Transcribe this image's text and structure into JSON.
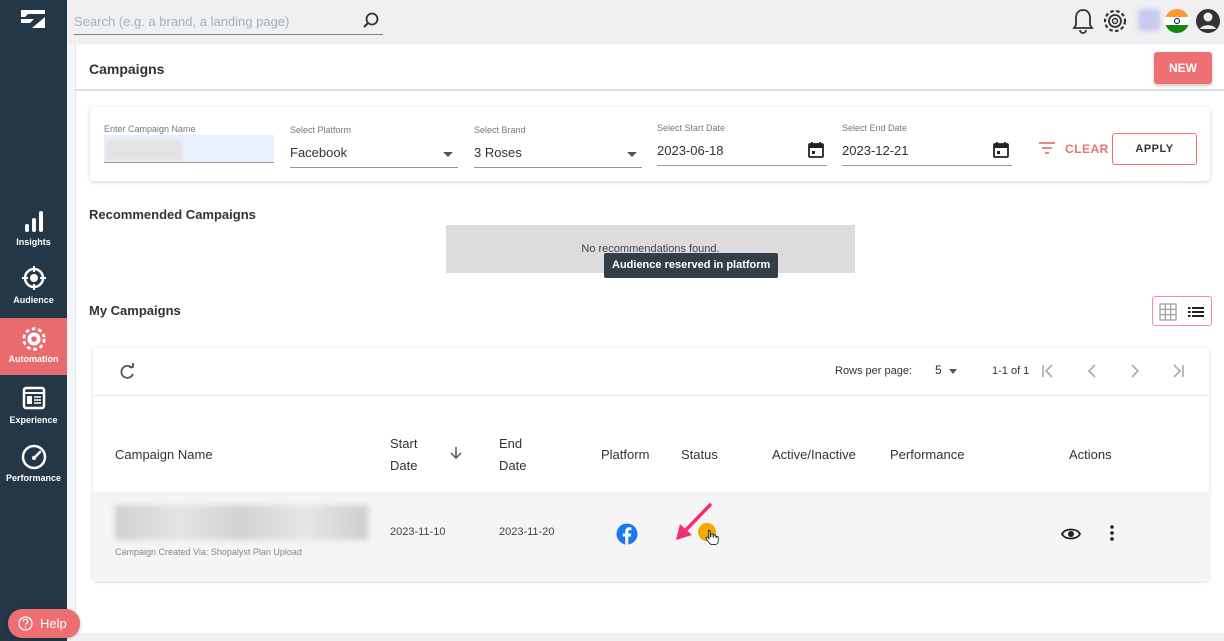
{
  "search": {
    "placeholder": "Search (e.g. a brand, a landing page)"
  },
  "sidebar": {
    "items": [
      {
        "label": "Insights",
        "icon": "bar-chart-icon"
      },
      {
        "label": "Audience",
        "icon": "target-icon"
      },
      {
        "label": "Automation",
        "icon": "gear-icon",
        "active": true
      },
      {
        "label": "Experience",
        "icon": "browser-icon"
      },
      {
        "label": "Performance",
        "icon": "speedometer-icon"
      }
    ]
  },
  "header": {
    "title": "Campaigns",
    "new_label": "NEW"
  },
  "filters": {
    "campaign_name_label": "Enter Campaign Name",
    "platform_label": "Select Platform",
    "platform_value": "Facebook",
    "brand_label": "Select Brand",
    "brand_value": "3 Roses",
    "start_label": "Select Start Date",
    "start_value": "2023-06-18",
    "end_label": "Select End Date",
    "end_value": "2023-12-21",
    "clear_label": "CLEAR",
    "apply_label": "APPLY"
  },
  "recommended": {
    "title": "Recommended Campaigns",
    "empty": "No recommendations found."
  },
  "my_campaigns": {
    "title": "My Campaigns",
    "rows_per_page_label": "Rows per page:",
    "rows_per_page": "5",
    "page_info": "1-1 of 1",
    "columns": {
      "name": "Campaign Name",
      "start_a": "Start",
      "start_b": "Date",
      "end_a": "End",
      "end_b": "Date",
      "platform": "Platform",
      "status": "Status",
      "active": "Active/Inactive",
      "performance": "Performance",
      "actions": "Actions"
    },
    "rows": [
      {
        "created_via": "Campaign Created Via: Shopalyst Plan Upload",
        "start": "2023-11-10",
        "end": "2023-11-20"
      }
    ]
  },
  "tooltip": "Audience reserved in platform",
  "help_label": "Help",
  "colors": {
    "accent": "#ed6f72",
    "sidebar": "#243747",
    "status": "#f2a900",
    "facebook": "#1877f2"
  }
}
